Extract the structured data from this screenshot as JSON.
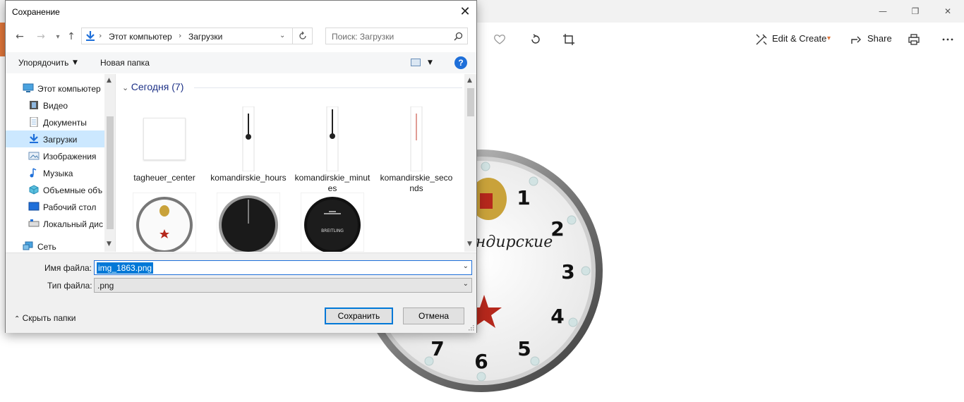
{
  "photos": {
    "toolbar": {
      "edit_create": "Edit & Create",
      "share": "Share"
    },
    "icons": {
      "favorite": "heart-icon",
      "rotate": "rotate-icon",
      "crop": "crop-icon",
      "edit": "edit-icon",
      "share": "share-icon",
      "print": "print-icon",
      "more": "more-icon"
    },
    "clock_numerals": [
      "1",
      "2",
      "3",
      "4",
      "5",
      "6",
      "7"
    ],
    "clock_text": "андирские",
    "accent_color": "#e0763a"
  },
  "dialog": {
    "title": "Сохранение",
    "address": {
      "segments": [
        "Этот компьютер",
        "Загрузки"
      ]
    },
    "search": {
      "placeholder": "Поиск: Загрузки"
    },
    "commands": {
      "organize": "Упорядочить",
      "new_folder": "Новая папка"
    },
    "sidebar": {
      "items": [
        {
          "label": "Этот компьютер",
          "icon": "computer-icon"
        },
        {
          "label": "Видео",
          "icon": "video-icon"
        },
        {
          "label": "Документы",
          "icon": "documents-icon"
        },
        {
          "label": "Загрузки",
          "icon": "downloads-icon",
          "selected": true
        },
        {
          "label": "Изображения",
          "icon": "pictures-icon"
        },
        {
          "label": "Музыка",
          "icon": "music-icon"
        },
        {
          "label": "Объемные объ",
          "icon": "3d-objects-icon"
        },
        {
          "label": "Рабочий стол",
          "icon": "desktop-icon"
        },
        {
          "label": "Локальный дис",
          "icon": "local-disk-icon"
        },
        {
          "label": "Сеть",
          "icon": "network-icon"
        }
      ]
    },
    "group": {
      "heading": "Сегодня (7)"
    },
    "files": [
      {
        "name": "tagheuer_center"
      },
      {
        "name": "komandirskie_hours"
      },
      {
        "name": "komandirskie_minutes"
      },
      {
        "name": "komandirskie_seconds"
      },
      {
        "name": ""
      },
      {
        "name": ""
      },
      {
        "name": ""
      }
    ],
    "breitling_text": "BREITLING",
    "bottom": {
      "filename_label": "Имя файла:",
      "filename_value": "img_1863.png",
      "filetype_label": "Тип файла:",
      "filetype_value": ".png",
      "hide_folders": "Скрыть папки",
      "save": "Сохранить",
      "cancel": "Отмена"
    },
    "help_symbol": "?",
    "accent_color": "#0078d7"
  }
}
